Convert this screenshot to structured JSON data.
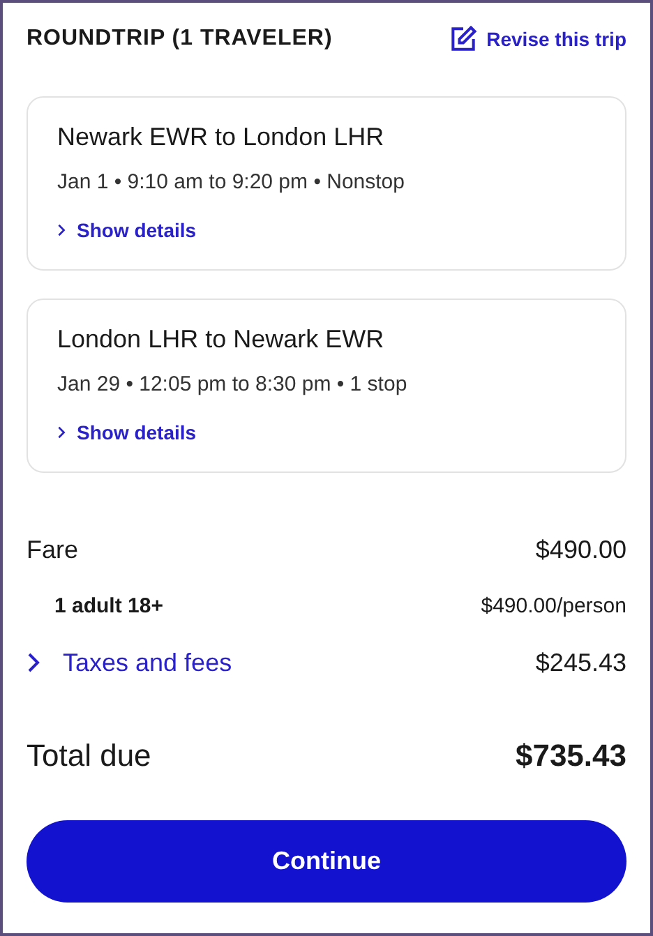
{
  "header": {
    "title": "ROUNDTRIP (1 TRAVELER)",
    "revise_link": "Revise this trip"
  },
  "flights": [
    {
      "route": "Newark EWR to London LHR",
      "summary": "Jan 1 • 9:10 am to 9:20 pm • Nonstop",
      "details_link": "Show details"
    },
    {
      "route": "London LHR to Newark EWR",
      "summary": "Jan 29 • 12:05 pm to 8:30 pm • 1 stop",
      "details_link": "Show details"
    }
  ],
  "price_lines": [
    {
      "kind": "main",
      "label": "Fare",
      "amount": "$490.00"
    },
    {
      "kind": "sub",
      "label": "1 adult 18+",
      "amount": "$490.00/person"
    },
    {
      "kind": "expandable",
      "label": "Taxes and fees",
      "amount": "$245.43"
    }
  ],
  "total": {
    "label": "Total due",
    "amount": "$735.43"
  },
  "continue_button": "Continue"
}
